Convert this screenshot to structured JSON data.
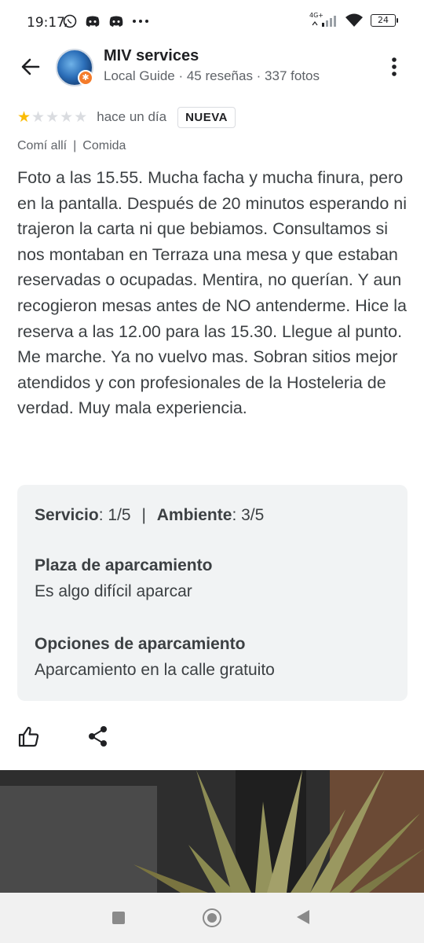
{
  "status_bar": {
    "time": "19:17",
    "network_label": "4G+",
    "battery": "24"
  },
  "header": {
    "author_name": "MIV services",
    "author_meta": "Local Guide · 45 reseñas · 337 fotos"
  },
  "review": {
    "rating": 1,
    "max_rating": 5,
    "date": "hace un día",
    "badge": "NUEVA",
    "tag_1": "Comí allí",
    "tag_separator": "|",
    "tag_2": "Comida",
    "text": "Foto a las 15.55. Mucha facha y mucha finura, pero en la pantalla. Después de 20 minutos esperando ni trajeron la carta ni que bebiamos. Consultamos si nos montaban en Terraza una mesa y que estaban reservadas o ocupadas. Mentira, no querían. Y aun recogieron mesas antes de NO antenderme. Hice la reserva a las 12.00 para las 15.30. Llegue al punto. Me marche. Ya no vuelvo mas. Sobran sitios mejor atendidos y con profesionales de la Hosteleria de verdad. Muy mala experiencia."
  },
  "attributes": {
    "service_label": "Servicio",
    "service_value": ": 1/5",
    "divider": "|",
    "ambience_label": "Ambiente",
    "ambience_value": ": 3/5",
    "parking_title": "Plaza de aparcamiento",
    "parking_value": "Es algo difícil aparcar",
    "parking_options_title": "Opciones de aparcamiento",
    "parking_options_value": "Aparcamiento en la calle gratuito"
  },
  "colors": {
    "star_filled": "#fbbc04",
    "star_empty": "#dadce0",
    "card_bg": "#f1f3f4",
    "text": "#3c4043",
    "secondary": "#5f6368"
  },
  "icons": [
    "back-arrow-icon",
    "more-vert-icon",
    "thumb-up-icon",
    "share-icon",
    "whatsapp-icon",
    "discord-icon",
    "wifi-icon",
    "signal-icon"
  ]
}
